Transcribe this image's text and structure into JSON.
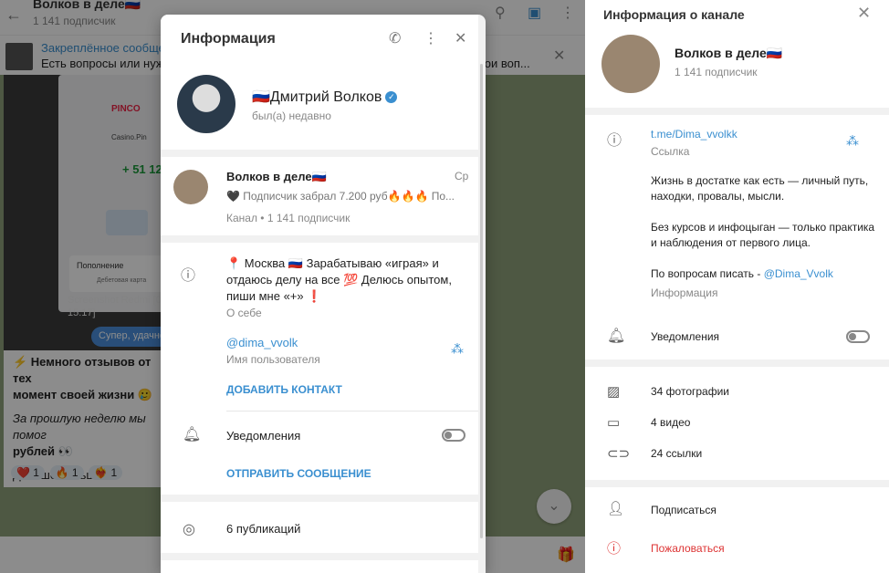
{
  "chat": {
    "title": "Волков в деле🇷🇺",
    "subscribers": "1 141 подписчик",
    "pinned_title": "Закреплённое сообще",
    "pinned_text": "Есть вопросы или нуж",
    "pinned_tail": "вои воп...",
    "image_brand": "PINCO",
    "image_casino": "Casino.Pin",
    "image_amount": "+ 51 12",
    "image_card_title": "Пополнение",
    "image_card_sub": "Дебетовая карта",
    "image_caption": "Screenshot Redmi [0\n15:17]",
    "reply_button": "Супер, удачно",
    "message_line1": "⚡ Немного отзывов от тех",
    "message_line2": "момент своей жизни 🥲",
    "message_line3": "За прошлую неделю мы помог",
    "message_line4": "рублей 👀",
    "message_line5": "Дальше больше🤝",
    "reactions": [
      {
        "emoji": "❤️",
        "count": "1"
      },
      {
        "emoji": "🔥",
        "count": "1"
      },
      {
        "emoji": "❤️‍🔥",
        "count": "1"
      }
    ]
  },
  "modal": {
    "title": "Информация",
    "profile_name": "🇷🇺Дмитрий Волков",
    "profile_status": "был(а) недавно",
    "channel_title": "Волков в деле🇷🇺",
    "channel_day": "Ср",
    "channel_last": "🖤 Подписчик забрал 7.200 руб🔥🔥🔥 По...",
    "channel_subs": "Канал • 1 141 подписчик",
    "about": "📍 Москва 🇷🇺 Зарабатываю «играя» и отдаюсь делу на все 💯 Делюсь опытом, пиши мне «+» ❗",
    "about_label": "О себе",
    "username": "@dima_vvolk",
    "username_label": "Имя пользователя",
    "add_contact": "ДОБАВИТЬ КОНТАКТ",
    "notifications": "Уведомления",
    "send_message": "ОТПРАВИТЬ СООБЩЕНИЕ",
    "publications": "6 публикаций"
  },
  "right": {
    "title": "Информация о канале",
    "name": "Волков в деле🇷🇺",
    "subscribers": "1 141 подписчик",
    "link": "t.me/Dima_vvolkk",
    "link_label": "Ссылка",
    "desc1": "Жизнь в достатке как есть — личный путь, находки, провалы, мысли.",
    "desc2": "Без курсов и инфоцыган — только практика и наблюдения от первого лица.",
    "desc3_prefix": "По вопросам писать - ",
    "desc3_link": "@Dima_Vvolk",
    "desc_label": "Информация",
    "notifications": "Уведомления",
    "photos": "34 фотографии",
    "videos": "4 видео",
    "links": "24 ссылки",
    "subscribe": "Подписаться",
    "report": "Пожаловаться"
  }
}
